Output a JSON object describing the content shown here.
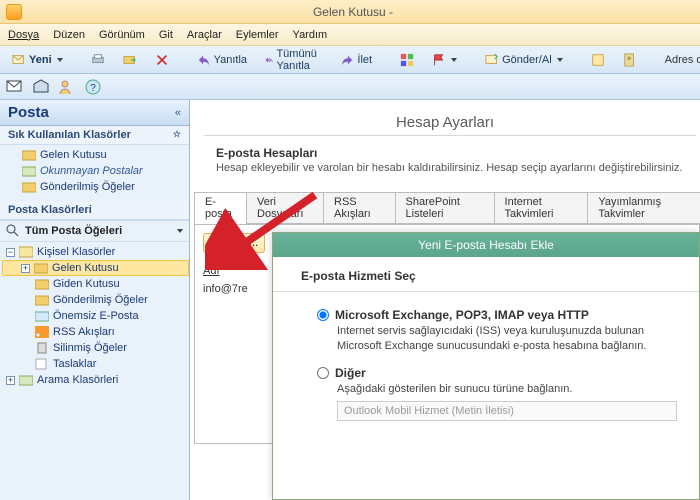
{
  "window": {
    "title": "Gelen Kutusu -"
  },
  "menubar": {
    "items": [
      "Dosya",
      "Düzen",
      "Görünüm",
      "Git",
      "Araçlar",
      "Eylemler",
      "Yardım"
    ]
  },
  "toolbar": {
    "new": "Yeni",
    "reply": "Yanıtla",
    "reply_all": "Tümünü Yanıtla",
    "forward": "İlet",
    "send_receive": "Gönder/Al",
    "address_book": "Adres defterleri"
  },
  "sidebar": {
    "title": "Posta",
    "chev": "«",
    "fav_header": "Sık Kullanılan Klasörler",
    "favorites": [
      {
        "label": "Gelen Kutusu",
        "italic": false
      },
      {
        "label": "Okunmayan Postalar",
        "italic": true
      },
      {
        "label": "Gönderilmiş Öğeler",
        "italic": false
      }
    ],
    "folders_header": "Posta Klasörleri",
    "all_mail": "Tüm Posta Öğeleri",
    "tree": {
      "root": "Kişisel Klasörler",
      "items": [
        {
          "label": "Gelen Kutusu",
          "sel": true,
          "exp": "+"
        },
        {
          "label": "Giden Kutusu"
        },
        {
          "label": "Gönderilmiş Öğeler"
        },
        {
          "label": "Önemsiz E-Posta"
        },
        {
          "label": "RSS Akışları"
        },
        {
          "label": "Silinmiş Öğeler"
        },
        {
          "label": "Taslaklar"
        }
      ],
      "search": {
        "label": "Arama Klasörleri",
        "exp": "+"
      }
    }
  },
  "settings": {
    "title": "Hesap Ayarları",
    "accounts_header": "E-posta Hesapları",
    "accounts_desc": "Hesap ekleyebilir ve varolan bir hesabı kaldırabilirsiniz. Hesap seçip ayarlarını değiştirebilirsiniz.",
    "tabs": [
      "E-posta",
      "Veri Dosyaları",
      "RSS Akışları",
      "SharePoint Listeleri",
      "Internet Takvimleri",
      "Yayımlanmış Takvimler"
    ],
    "new_btn": "Yeni...",
    "col_name": "Adı",
    "row0_name": "info@7re"
  },
  "wizard": {
    "title": "Yeni E-posta Hesabı Ekle",
    "step": "E-posta Hizmeti Seç",
    "opt1_label": "Microsoft Exchange, POP3, IMAP veya HTTP",
    "opt1_desc": "Internet servis sağlayıcıdaki (ISS) veya kuruluşunuzda bulunan Microsoft Exchange sunucusundaki e-posta hesabına bağlanın.",
    "opt2_label": "Diğer",
    "opt2_desc": "Aşağıdaki gösterilen bir sunucu türüne bağlanın.",
    "disabled_option": "Outlook Mobil Hizmet (Metin İletisi)"
  }
}
